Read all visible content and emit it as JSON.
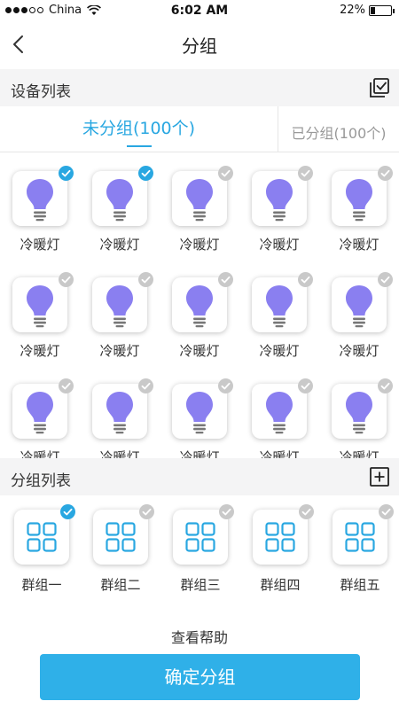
{
  "status_bar": {
    "carrier": "China",
    "time": "6:02 AM",
    "battery": "22%",
    "battery_fraction": 0.22
  },
  "nav": {
    "title": "分组"
  },
  "device_section": {
    "label": "设备列表"
  },
  "tabs": {
    "ungrouped": "未分组(100个)",
    "grouped": "已分组(100个)"
  },
  "devices": [
    {
      "name": "冷暖灯",
      "checked": true
    },
    {
      "name": "冷暖灯",
      "checked": true
    },
    {
      "name": "冷暖灯",
      "checked": false
    },
    {
      "name": "冷暖灯",
      "checked": false
    },
    {
      "name": "冷暖灯",
      "checked": false
    },
    {
      "name": "冷暖灯",
      "checked": false
    },
    {
      "name": "冷暖灯",
      "checked": false
    },
    {
      "name": "冷暖灯",
      "checked": false
    },
    {
      "name": "冷暖灯",
      "checked": false
    },
    {
      "name": "冷暖灯",
      "checked": false
    },
    {
      "name": "冷暖灯",
      "checked": false
    },
    {
      "name": "冷暖灯",
      "checked": false
    },
    {
      "name": "冷暖灯",
      "checked": false
    },
    {
      "name": "冷暖灯",
      "checked": false
    },
    {
      "name": "冷暖灯",
      "checked": false
    }
  ],
  "group_section": {
    "label": "分组列表"
  },
  "groups": [
    {
      "name": "群组一",
      "checked": true
    },
    {
      "name": "群组二",
      "checked": false
    },
    {
      "name": "群组三",
      "checked": false
    },
    {
      "name": "群组四",
      "checked": false
    },
    {
      "name": "群组五",
      "checked": false
    }
  ],
  "help": {
    "label": "查看帮助"
  },
  "confirm": {
    "label": "确定分组"
  },
  "colors": {
    "accent": "#29a7e1",
    "bulb": "#8a7ff0",
    "check_off": "#c9c9c9",
    "section_bg": "#f4f4f5"
  },
  "icons": {
    "back": "chevron-left-icon",
    "multi_select": "multi-select-icon",
    "add": "plus-square-icon",
    "device": "bulb-icon",
    "group": "grid-icon",
    "check": "check-circle-icon"
  }
}
